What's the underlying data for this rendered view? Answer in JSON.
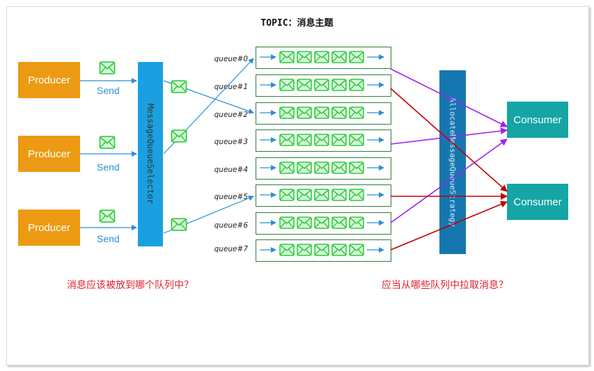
{
  "title": "TOPIC：消息主题",
  "producers": [
    {
      "label": "Producer",
      "send_label": "Send"
    },
    {
      "label": "Producer",
      "send_label": "Send"
    },
    {
      "label": "Producer",
      "send_label": "Send"
    }
  ],
  "selector_label": "MessageQueueSelector",
  "queues": [
    "queue#0",
    "queue#1",
    "queue#2",
    "queue#3",
    "queue#4",
    "queue#5",
    "queue#6",
    "queue#7"
  ],
  "strategy_label": "AllocateMessageQueueStrategy",
  "consumers": [
    "Consumer",
    "Consumer"
  ],
  "questions": {
    "left": "消息应该被放到哪个队列中？",
    "right": "应当从哪些队列中拉取消息？"
  },
  "colors": {
    "producer": "#ec9a13",
    "selector": "#1aa0e0",
    "strategy": "#1677b0",
    "consumer": "#15a5a5",
    "message_icon": "#2ecc40",
    "send_arrow": "#2a8fd6",
    "consumer1_arrow": "#a020f0",
    "consumer2_arrow": "#c00000",
    "question_text": "#e0202a"
  },
  "icons": [
    "envelope-icon"
  ]
}
